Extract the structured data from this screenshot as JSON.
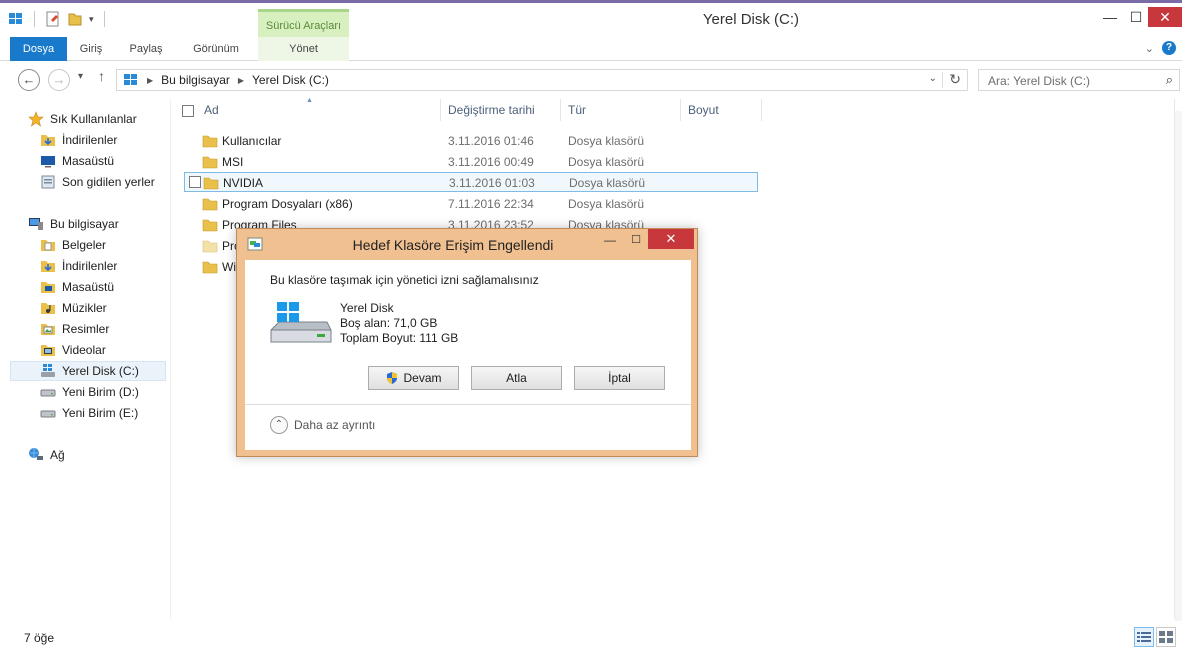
{
  "window": {
    "title": "Yerel Disk (C:)",
    "contextual_tab_header": "Sürücü Araçları",
    "minimize": "—",
    "maximize": "☐",
    "close": "✕"
  },
  "ribbon": {
    "tabs": [
      {
        "label": "Dosya"
      },
      {
        "label": "Giriş"
      },
      {
        "label": "Paylaş"
      },
      {
        "label": "Görünüm"
      },
      {
        "label": "Yönet"
      }
    ],
    "help": "?"
  },
  "address": {
    "breadcrumbs": [
      "Bu bilgisayar",
      "Yerel Disk (C:)"
    ],
    "search_placeholder": "Ara: Yerel Disk (C:)"
  },
  "nav_pane": {
    "favorites_header": "Sık Kullanılanlar",
    "favorites": [
      "İndirilenler",
      "Masaüstü",
      "Son gidilen yerler"
    ],
    "computer_header": "Bu bilgisayar",
    "computer_items": [
      "Belgeler",
      "İndirilenler",
      "Masaüstü",
      "Müzikler",
      "Resimler",
      "Videolar",
      "Yerel Disk (C:)",
      "Yeni Birim (D:)",
      "Yeni Birim (E:)"
    ],
    "network": "Ağ"
  },
  "columns": {
    "name": "Ad",
    "modified": "Değiştirme tarihi",
    "type": "Tür",
    "size": "Boyut"
  },
  "files": [
    {
      "name": "Kullanıcılar",
      "date": "3.11.2016 01:46",
      "type": "Dosya klasörü"
    },
    {
      "name": "MSI",
      "date": "3.11.2016 00:49",
      "type": "Dosya klasörü"
    },
    {
      "name": "NVIDIA",
      "date": "3.11.2016 01:03",
      "type": "Dosya klasörü"
    },
    {
      "name": "Program Dosyaları (x86)",
      "date": "7.11.2016 22:34",
      "type": "Dosya klasörü"
    },
    {
      "name": "Program Files",
      "date": "3.11.2016 23:52",
      "type": "Dosya klasörü"
    },
    {
      "name": "Pro",
      "date": "",
      "type": ""
    },
    {
      "name": "Wi",
      "date": "",
      "type": ""
    }
  ],
  "status": {
    "item_count": "7 öğe"
  },
  "dialog": {
    "title": "Hedef Klasöre Erişim Engellendi",
    "message": "Bu klasöre taşımak için yönetici izni sağlamalısınız",
    "drive_name": "Yerel Disk",
    "free_space": "Boş alan: 71,0 GB",
    "total_size": "Toplam Boyut: 111 GB",
    "continue_label": "Devam",
    "skip_label": "Atla",
    "cancel_label": "İptal",
    "less_details": "Daha az ayrıntı"
  },
  "colors": {
    "accent": "#1979ca",
    "dialog_frame": "#f0c090",
    "close_red": "#c7373c",
    "context_tab": "#d8f0c0",
    "folder": "#e8c04a"
  }
}
